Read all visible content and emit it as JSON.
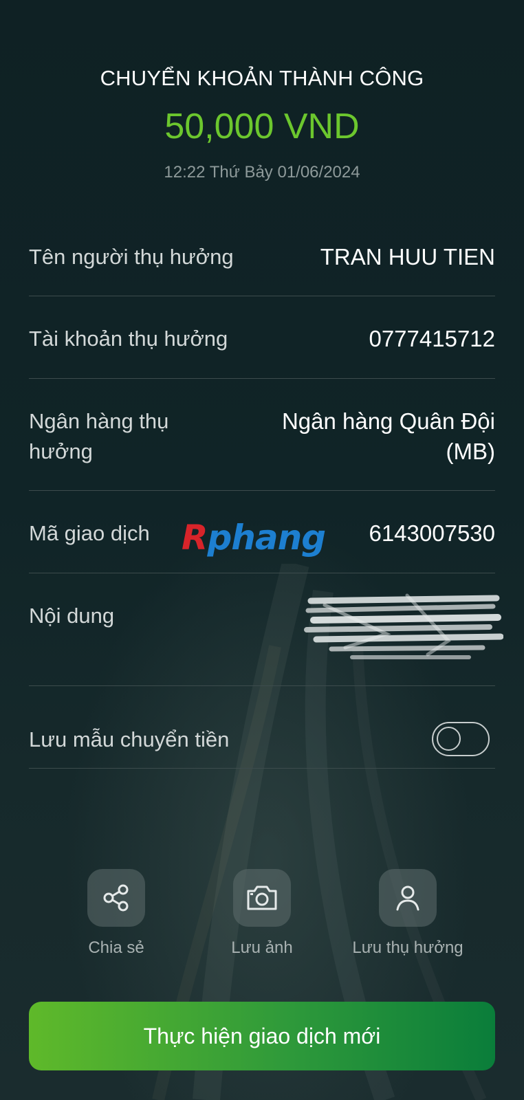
{
  "header": {
    "title": "CHUYỂN KHOẢN THÀNH CÔNG",
    "amount": "50,000 VND",
    "datetime": "12:22 Thứ Bảy 01/06/2024"
  },
  "details": {
    "beneficiary_name": {
      "label": "Tên người thụ hưởng",
      "value": "TRAN HUU TIEN"
    },
    "beneficiary_account": {
      "label": "Tài khoản thụ hưởng",
      "value": "0777415712"
    },
    "beneficiary_bank": {
      "label": "Ngân hàng thụ hưởng",
      "value": "Ngân hàng Quân Đội (MB)"
    },
    "transaction_id": {
      "label": "Mã giao dịch",
      "value": "6143007530"
    },
    "content": {
      "label": "Nội dung",
      "value": ""
    },
    "save_template": {
      "label": "Lưu mẫu chuyển tiền",
      "enabled": false
    }
  },
  "watermark": {
    "part1": "R",
    "part2": "phang"
  },
  "actions": [
    {
      "label": "Chia sẻ",
      "icon": "share-icon"
    },
    {
      "label": "Lưu ảnh",
      "icon": "camera-icon"
    },
    {
      "label": "Lưu thụ hưởng",
      "icon": "user-icon"
    }
  ],
  "primary_button": {
    "label": "Thực hiện giao dịch mới"
  },
  "colors": {
    "amount": "#6cc72e",
    "background": "#0e1f22",
    "button_gradient_start": "#5fb92a",
    "button_gradient_end": "#0a7d3a",
    "watermark_red": "#d8242a",
    "watermark_blue": "#1d7fd0"
  }
}
